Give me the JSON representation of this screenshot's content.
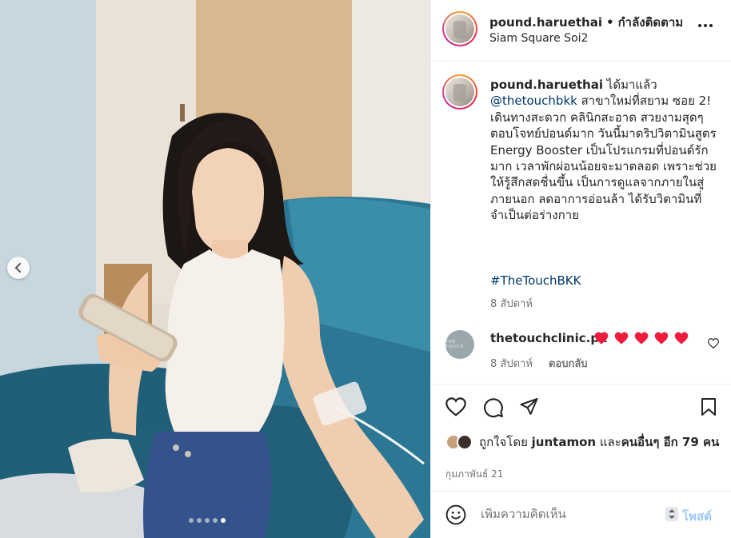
{
  "post": {
    "username": "pound.haruethai",
    "follow_status": "กำลังติดตาม",
    "location": "Siam Square Soi2",
    "caption": {
      "username": "pound.haruethai",
      "text_before_mention": "ได้มาแล้ว",
      "mention": "@thetouchbkk",
      "text_after_mention": "สาขาใหม่ที่สยาม ซอย 2! เดินทางสะดวก คลินิกสะอาด สวยงามสุดๆ ตอบโจทย์ปอนด์มาก วันนี้มาดริปวิตามินสูตร Energy Booster เป็นโปรแกรมที่ปอนด์รักมาก เวลาพักผ่อนน้อยจะมาตลอด เพราะช่วยให้รู้สึกสดชื่นขึ้น เป็นการดูแลจากภายในสู่ภายนอก ลดอาการอ่อนล้า ได้รับวิตามินที่จำเป็นต่อร่างกาย",
      "hashtag": "#TheTouchBKK",
      "time": "8 สัปดาห์"
    },
    "comment": {
      "username": "thetouchclinic.pk",
      "avatar_text": "THE TOUCH",
      "hearts": 5,
      "heart_color": "#ed1c3c",
      "time": "8 สัปดาห์",
      "reply_label": "ตอบกลับ"
    },
    "likes": {
      "prefix": "ถูกใจโดย",
      "user": "juntamon",
      "conjunction": "และ",
      "others": "คนอื่นๆ อีก 79 คน"
    },
    "date": "กุมภาพันธ์ 21",
    "comment_input": {
      "placeholder": "เพิ่มความคิดเห็น",
      "post_label": "โพสต์"
    },
    "carousel": {
      "total": 5,
      "active_index": 4
    }
  },
  "colors": {
    "link": "#00376b",
    "secondary_text": "#737373",
    "post_button": "#9ec9f5",
    "sofa": "#2b6f8a"
  },
  "icons": {
    "more": "ellipsis-icon",
    "prev": "chevron-left-icon",
    "like": "heart-outline-icon",
    "comment": "speech-bubble-icon",
    "share": "paper-plane-icon",
    "save": "bookmark-icon",
    "emoji": "smiley-icon",
    "comment_like": "small-heart-icon"
  }
}
